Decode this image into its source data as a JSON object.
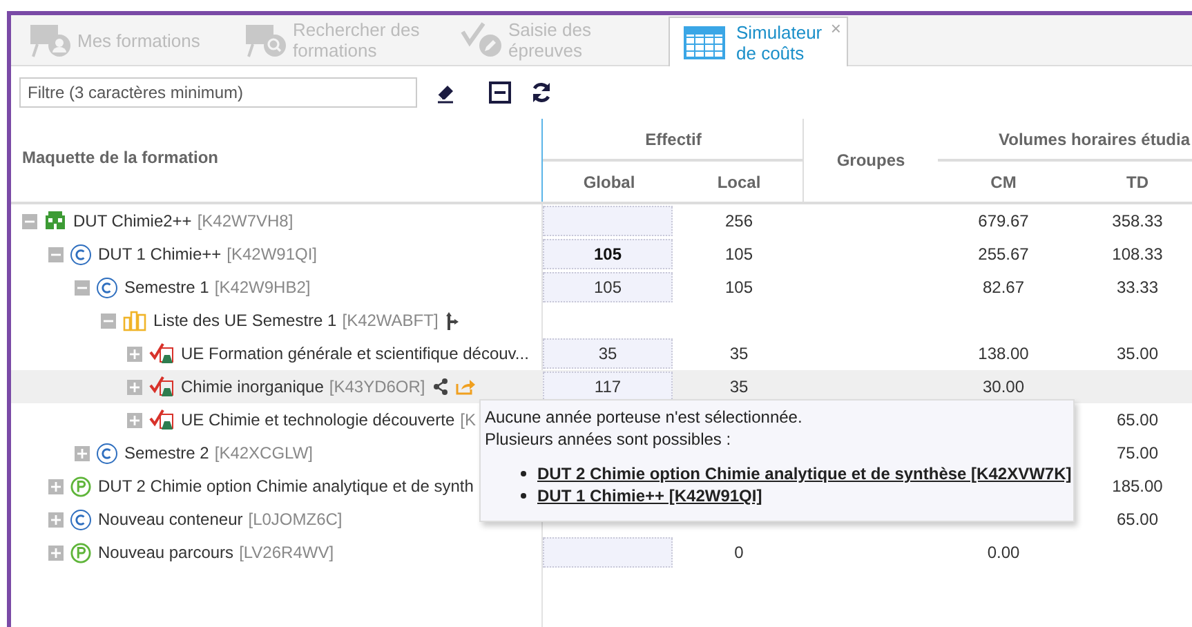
{
  "tabs": [
    {
      "label": "Mes formations",
      "selected": false,
      "kind": "person"
    },
    {
      "label": "Rechercher des formations",
      "selected": false,
      "kind": "search"
    },
    {
      "label": "Saisie des épreuves",
      "selected": false,
      "kind": "edit"
    },
    {
      "label": "Simulateur de coûts",
      "selected": true,
      "kind": "grid",
      "close": "×"
    }
  ],
  "filter": {
    "placeholder": "Filtre (3 caractères minimum)"
  },
  "table": {
    "header": {
      "tree": "Maquette de la formation",
      "effectif": "Effectif",
      "global": "Global",
      "local": "Local",
      "groupes": "Groupes",
      "volumes": "Volumes horaires étudia",
      "cm": "CM",
      "td": "TD"
    },
    "rows": [
      {
        "kind": "diploma",
        "label": "DUT Chimie2++",
        "code": "[K42W7VH8]",
        "expanded": true,
        "selected": false,
        "global_cell": true,
        "local": "256",
        "cm": "679.67",
        "td": "358.33",
        "children": [
          {
            "kind": "container",
            "label": "DUT 1 Chimie++",
            "code": "[K42W91QI]",
            "expanded": true,
            "selected": false,
            "global_cell": true,
            "global": "105",
            "global_bold": true,
            "local": "105",
            "cm": "255.67",
            "td": "108.33",
            "children": [
              {
                "kind": "container",
                "label": "Semestre 1",
                "code": "[K42W9HB2]",
                "expanded": true,
                "selected": false,
                "global_cell": true,
                "global": "105",
                "global_bold": false,
                "local": "105",
                "cm": "82.67",
                "td": "33.33",
                "children": [
                  {
                    "kind": "list",
                    "label": "Liste des UE Semestre 1",
                    "code": "[K42WABFT]",
                    "expanded": true,
                    "selected": false,
                    "global_cell": false,
                    "markers": [
                      {
                        "kind": "branch"
                      }
                    ],
                    "children": [
                      {
                        "kind": "ue",
                        "label": "UE Formation générale et scientifique découv...",
                        "expanded": false,
                        "selected": false,
                        "global_cell": true,
                        "global": "35",
                        "global_bold": false,
                        "local": "35",
                        "cm": "138.00",
                        "td": "35.00"
                      },
                      {
                        "kind": "ue",
                        "label": "Chimie inorganique",
                        "code": "[K43YD6OR]",
                        "expanded": false,
                        "selected": true,
                        "global_cell": true,
                        "global": "117",
                        "global_bold": false,
                        "local": "35",
                        "cm": "30.00",
                        "markers": [
                          {
                            "kind": "share"
                          },
                          {
                            "kind": "export"
                          }
                        ]
                      },
                      {
                        "kind": "ue",
                        "label": "UE Chimie et technologie découverte",
                        "code": "[K",
                        "expanded": false,
                        "selected": false,
                        "global_cell": false,
                        "td": "65.00"
                      }
                    ]
                  }
                ]
              },
              {
                "kind": "container",
                "label": "Semestre 2",
                "code": "[K42XCGLW]",
                "expanded": false,
                "selected": false,
                "global_cell": false,
                "td": "75.00"
              }
            ]
          },
          {
            "kind": "parcours",
            "label": "DUT 2 Chimie option Chimie analytique et de synth",
            "expanded": false,
            "selected": false,
            "global_cell": false,
            "td": "185.00"
          },
          {
            "kind": "container",
            "label": "Nouveau conteneur",
            "code": "[L0JOMZ6C]",
            "expanded": false,
            "selected": false,
            "global_cell": false,
            "td": "65.00"
          },
          {
            "kind": "parcours",
            "label": "Nouveau parcours",
            "code": "[LV26R4WV]",
            "expanded": false,
            "selected": false,
            "global_cell": true,
            "local": "0",
            "cm": "0.00"
          }
        ]
      }
    ]
  },
  "tooltip": {
    "lines": [
      "Aucune année porteuse n'est sélectionnée.",
      "Plusieurs années sont possibles :"
    ],
    "links": [
      "DUT 2 Chimie option Chimie analytique et de synthèse [K42XVW7K]",
      "DUT 1 Chimie++ [K42W91QI]"
    ]
  }
}
